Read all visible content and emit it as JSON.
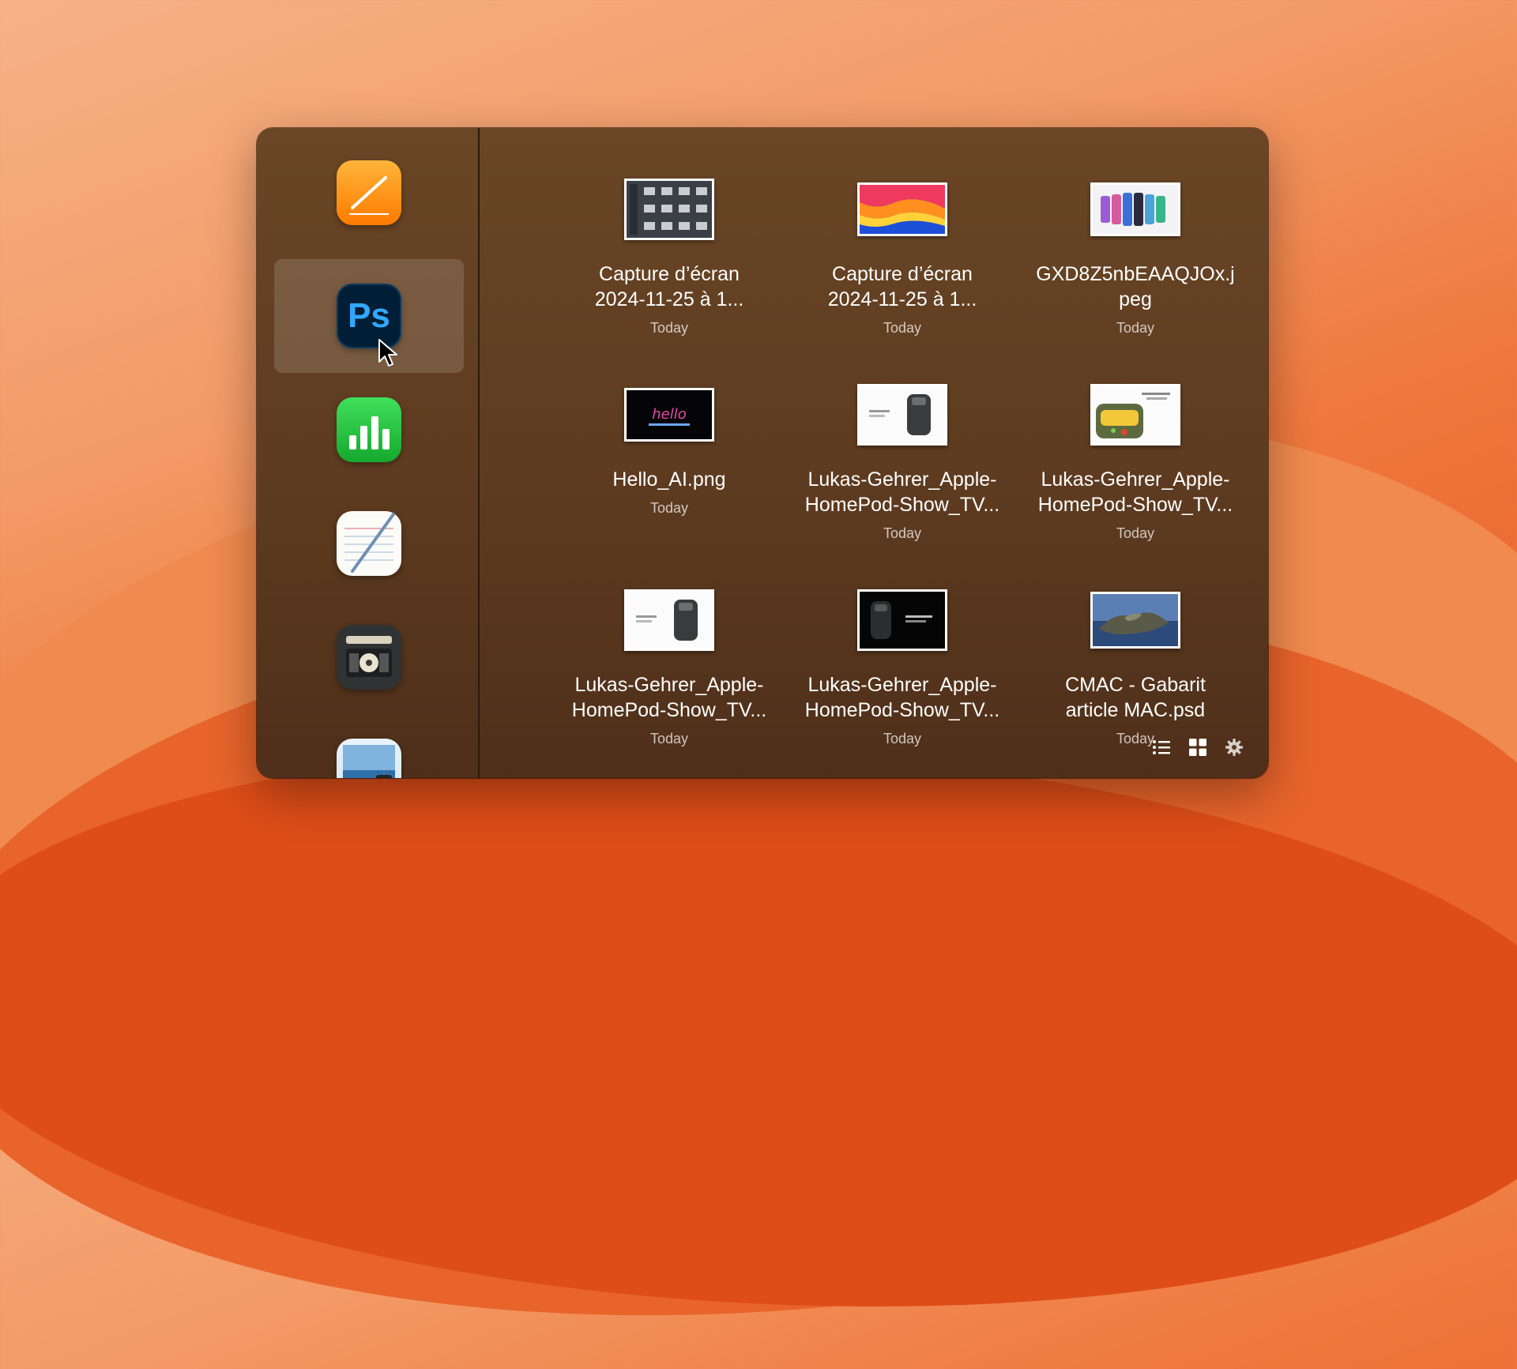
{
  "sidebar": {
    "apps": [
      {
        "name": "Pages",
        "icon": "pages-icon"
      },
      {
        "name": "Adobe Photoshop",
        "icon": "photoshop-icon",
        "label": "Ps",
        "selected": true
      },
      {
        "name": "Numbers",
        "icon": "numbers-icon"
      },
      {
        "name": "TextEdit",
        "icon": "textedit-icon"
      },
      {
        "name": "Sound app",
        "icon": "sound-app-icon"
      },
      {
        "name": "Preview",
        "icon": "preview-icon"
      }
    ]
  },
  "files": [
    {
      "name": "Capture d’écran\n2024-11-25 à 1...",
      "date": "Today",
      "thumb": "screenshot-grid"
    },
    {
      "name": "Capture d’écran\n2024-11-25 à 1...",
      "date": "Today",
      "thumb": "wallpaper-gradient"
    },
    {
      "name": "GXD8Z5nbEAAQJOx.j\npeg",
      "date": "Today",
      "thumb": "phones"
    },
    {
      "name": "Hello_AI.png",
      "date": "Today",
      "thumb": "hello-dark"
    },
    {
      "name": "Lukas-Gehrer_Apple-\nHomePod-Show_TV...",
      "date": "Today",
      "thumb": "homepod-white"
    },
    {
      "name": "Lukas-Gehrer_Apple-\nHomePod-Show_TV...",
      "date": "Today",
      "thumb": "homepod-colorful"
    },
    {
      "name": "Lukas-Gehrer_Apple-\nHomePod-Show_TV...",
      "date": "Today",
      "thumb": "homepod-white"
    },
    {
      "name": "Lukas-Gehrer_Apple-\nHomePod-Show_TV...",
      "date": "Today",
      "thumb": "homepod-dark"
    },
    {
      "name": "CMAC - Gabarit\narticle MAC.psd",
      "date": "Today",
      "thumb": "catalina"
    }
  ],
  "toolbar": {
    "list_view": "list-view-icon",
    "grid_view": "grid-view-icon",
    "settings": "gear-icon"
  },
  "colors": {
    "panel": "#5c3a1f",
    "selection": "rgba(255,255,255,0.14)",
    "text": "#ffffff"
  }
}
